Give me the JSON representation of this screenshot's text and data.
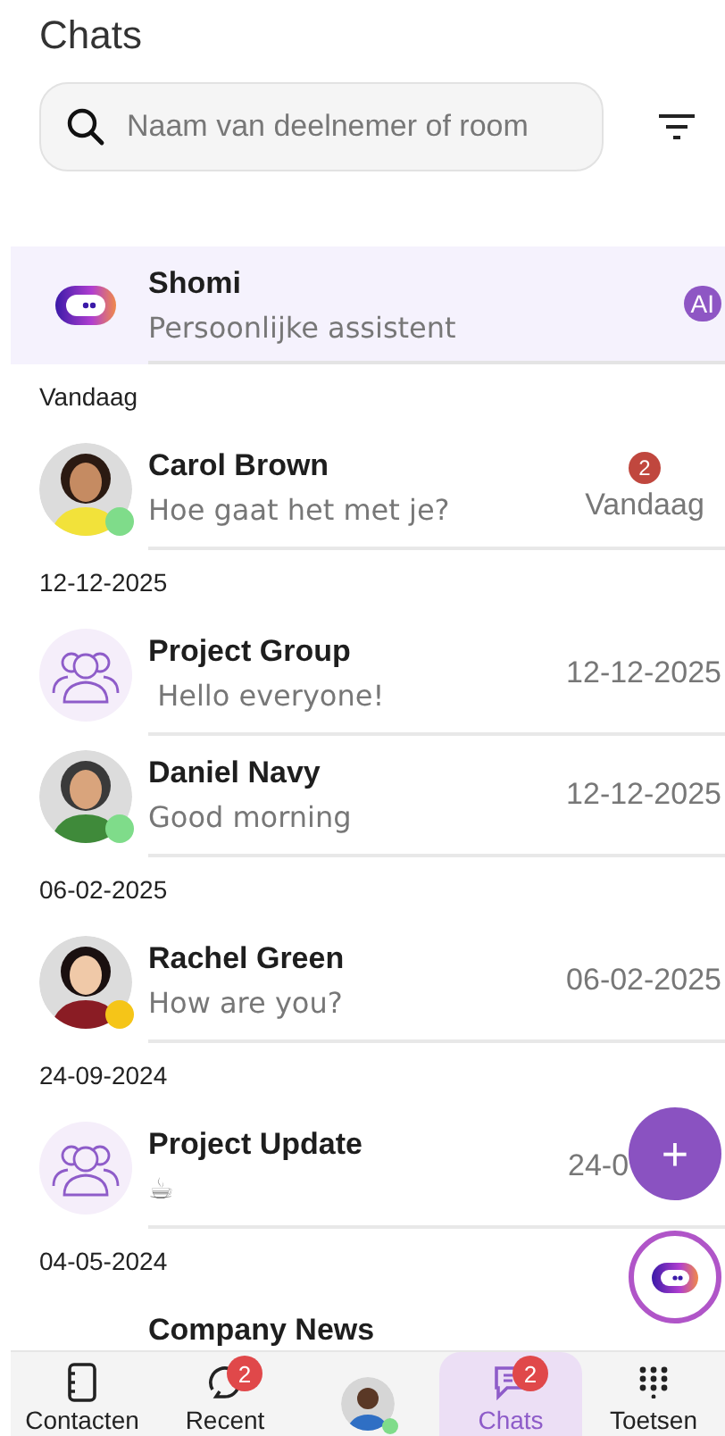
{
  "header": {
    "title": "Chats"
  },
  "search": {
    "placeholder": "Naam van deelnemer of room"
  },
  "pinned": {
    "kind": "assistant",
    "name": "Shomi",
    "message": "Persoonlijke assistent",
    "badge": "AI"
  },
  "sections": [
    {
      "label": "Vandaag",
      "chats": [
        {
          "kind": "person",
          "name": "Carol Brown",
          "message": "Hoe gaat het met je?",
          "time": "Vandaag",
          "unread": "2",
          "color": "#7fdc8a"
        }
      ]
    },
    {
      "label": "12-12-2025",
      "chats": [
        {
          "kind": "group",
          "name": "Project Group",
          "message": " Hello everyone!",
          "time": "12-12-2025"
        },
        {
          "kind": "person",
          "name": "Daniel Navy",
          "message": "Good morning",
          "time": "12-12-2025",
          "color": "#7fdc8a"
        }
      ]
    },
    {
      "label": "06-02-2025",
      "chats": [
        {
          "kind": "person",
          "name": "Rachel Green",
          "message": "How are you?",
          "time": "06-02-2025",
          "color": "#f5c518"
        }
      ]
    },
    {
      "label": "24-09-2024",
      "chats": [
        {
          "kind": "group",
          "name": "Project Update",
          "message": "☕",
          "time": "24-0"
        }
      ]
    },
    {
      "label": "04-05-2024",
      "chats": [
        {
          "name": "Company News"
        }
      ]
    }
  ],
  "fab": {
    "label": "+"
  },
  "nav": [
    {
      "kind": "contacts",
      "label": "Contacten",
      "selected": false
    },
    {
      "kind": "recent",
      "label": "Recent",
      "badge": "2",
      "selected": false
    },
    {
      "kind": "profile",
      "color": "#7fdc8a",
      "selected": false
    },
    {
      "kind": "chats",
      "label": "Chats",
      "badge": "2",
      "selected": true
    },
    {
      "kind": "keypad",
      "label": "Toetsen",
      "selected": false
    }
  ]
}
